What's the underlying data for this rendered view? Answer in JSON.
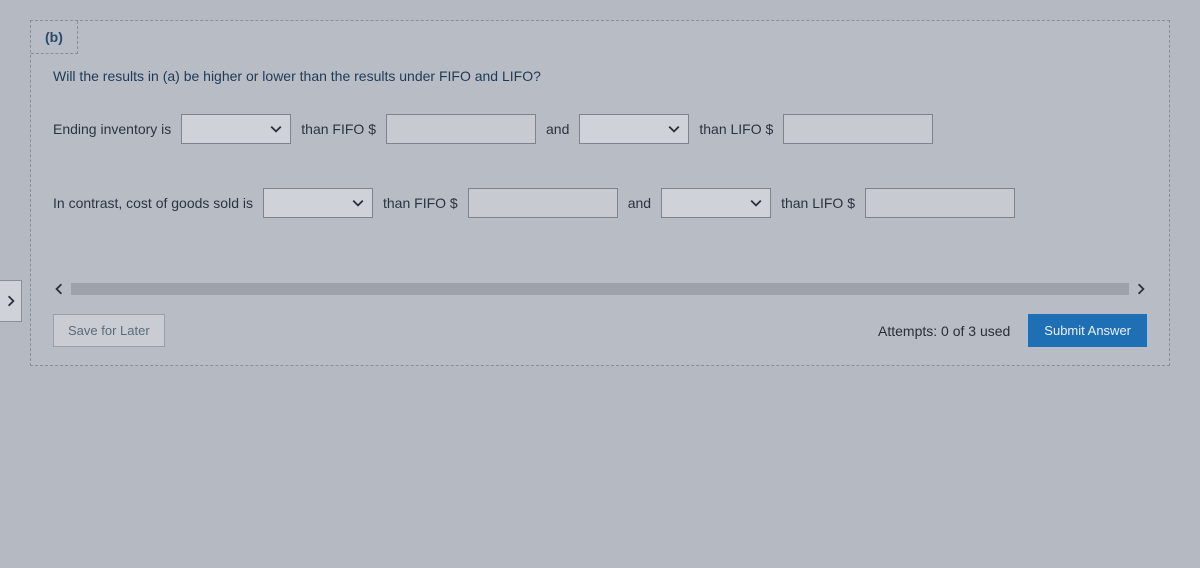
{
  "part_label": "(b)",
  "prompt": "Will the results in (a) be higher or lower than the results under FIFO and LIFO?",
  "row1": {
    "lead": "Ending inventory is",
    "mid1": "than FIFO $",
    "and": "and",
    "mid2": "than LIFO $"
  },
  "row2": {
    "lead": "In contrast, cost of goods sold is",
    "mid1": "than FIFO $",
    "and": "and",
    "mid2": "than LIFO $"
  },
  "save_label": "Save for Later",
  "attempts": "Attempts: 0 of 3 used",
  "submit_label": "Submit Answer"
}
